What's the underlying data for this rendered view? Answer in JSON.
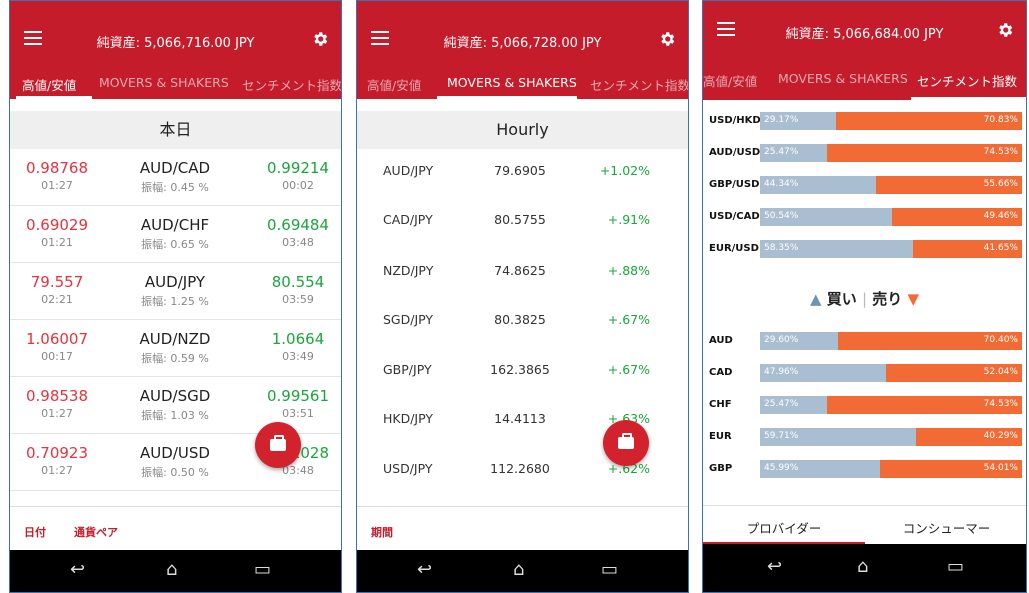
{
  "colors": {
    "brand_red": "#c51c2c",
    "buy_blue": "#a9bfd1",
    "sell_orange": "#f26b35",
    "low_red": "#e8313b",
    "high_green": "#1aa53a"
  },
  "icons": {
    "menu": "hamburger-icon",
    "settings": "gear-icon",
    "trade": "briefcase-icon",
    "back": "back-icon",
    "home": "home-icon",
    "recents": "recents-icon"
  },
  "screen1": {
    "title": "純資産: 5,066,716.00 JPY",
    "tabs": [
      "高値/安値",
      "MOVERS & SHAKERS",
      "センチメント指数"
    ],
    "section": "本日",
    "rows": [
      {
        "low": "0.98768",
        "low_time": "01:27",
        "pair": "AUD/CAD",
        "range": "振幅: 0.45 %",
        "high": "0.99214",
        "high_time": "00:02"
      },
      {
        "low": "0.69029",
        "low_time": "01:21",
        "pair": "AUD/CHF",
        "range": "振幅: 0.65 %",
        "high": "0.69484",
        "high_time": "03:48"
      },
      {
        "low": "79.557",
        "low_time": "02:21",
        "pair": "AUD/JPY",
        "range": "振幅: 1.25 %",
        "high": "80.554",
        "high_time": "03:59"
      },
      {
        "low": "1.06007",
        "low_time": "00:17",
        "pair": "AUD/NZD",
        "range": "振幅: 0.59 %",
        "high": "1.0664",
        "high_time": "03:49"
      },
      {
        "low": "0.98538",
        "low_time": "01:27",
        "pair": "AUD/SGD",
        "range": "振幅: 1.03 %",
        "high": "0.99561",
        "high_time": "03:51"
      },
      {
        "low": "0.70923",
        "low_time": "01:27",
        "pair": "AUD/USD",
        "range": "振幅: 0.50 %",
        "high": "0.71028",
        "high_time": "03:48"
      }
    ],
    "footer": [
      "日付",
      "通貨ペア"
    ]
  },
  "screen2": {
    "title": "純資産: 5,066,728.00 JPY",
    "tabs": [
      "高値/安値",
      "MOVERS & SHAKERS",
      "センチメント指数"
    ],
    "section": "Hourly",
    "rows": [
      {
        "pair": "AUD/JPY",
        "price": "79.6905",
        "change": "+1.02%"
      },
      {
        "pair": "CAD/JPY",
        "price": "80.5755",
        "change": "+.91%"
      },
      {
        "pair": "NZD/JPY",
        "price": "74.8625",
        "change": "+.88%"
      },
      {
        "pair": "SGD/JPY",
        "price": "80.3825",
        "change": "+.67%"
      },
      {
        "pair": "GBP/JPY",
        "price": "162.3865",
        "change": "+.67%"
      },
      {
        "pair": "HKD/JPY",
        "price": "14.4113",
        "change": "+.63%"
      },
      {
        "pair": "USD/JPY",
        "price": "112.2680",
        "change": "+.62%"
      }
    ],
    "footer": [
      "期間"
    ]
  },
  "screen3": {
    "title": "純資産: 5,066,684.00 JPY",
    "tabs": [
      "高値/安値",
      "MOVERS & SHAKERS",
      "センチメント指数"
    ],
    "pairs": [
      {
        "label": "USD/HKD",
        "buy": "29.17%",
        "sell": "70.83%",
        "buy_frac": 0.2917
      },
      {
        "label": "AUD/USD",
        "buy": "25.47%",
        "sell": "74.53%",
        "buy_frac": 0.2547
      },
      {
        "label": "GBP/USD",
        "buy": "44.34%",
        "sell": "55.66%",
        "buy_frac": 0.4434
      },
      {
        "label": "USD/CAD",
        "buy": "50.54%",
        "sell": "49.46%",
        "buy_frac": 0.5054
      },
      {
        "label": "EUR/USD",
        "buy": "58.35%",
        "sell": "41.65%",
        "buy_frac": 0.5835
      }
    ],
    "legend": {
      "buy": "買い",
      "sell": "売り",
      "buy_arrow": "▲",
      "sell_arrow": "▼",
      "sep": "|"
    },
    "currencies": [
      {
        "label": "AUD",
        "buy": "29.60%",
        "sell": "70.40%",
        "buy_frac": 0.296
      },
      {
        "label": "CAD",
        "buy": "47.96%",
        "sell": "52.04%",
        "buy_frac": 0.4796
      },
      {
        "label": "CHF",
        "buy": "25.47%",
        "sell": "74.53%",
        "buy_frac": 0.2547
      },
      {
        "label": "EUR",
        "buy": "59.71%",
        "sell": "40.29%",
        "buy_frac": 0.5971
      },
      {
        "label": "GBP",
        "buy": "45.99%",
        "sell": "54.01%",
        "buy_frac": 0.4599
      }
    ],
    "bottom_tabs": [
      "プロバイダー",
      "コンシューマー"
    ]
  }
}
